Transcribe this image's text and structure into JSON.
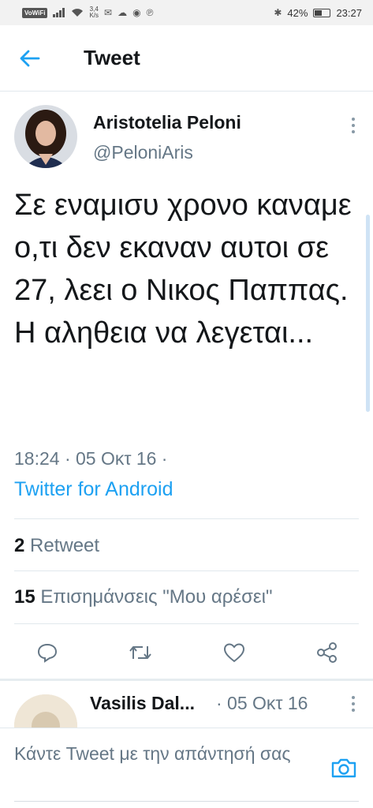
{
  "status_bar": {
    "vowifi": "VoWiFi",
    "speed_value": "3,4",
    "speed_unit": "K/s",
    "battery": "42%",
    "time": "23:27"
  },
  "header": {
    "title": "Tweet"
  },
  "tweet": {
    "author_name": "Aristotelia Peloni",
    "author_handle": "@PeloniAris",
    "text": "Σε εναμισυ χρονο καναμε ο,τι δεν εκαναν αυτοι σε 27, λεει ο Νικος Παππας. Η αληθεια να λεγεται...",
    "timestamp": "18:24 · 05 Οκτ 16 ·",
    "source": "Twitter for Android",
    "retweet_count": "2",
    "retweet_label": "Retweet",
    "like_count": "15",
    "like_label": "Επισημάνσεις \"Μου αρέσει\""
  },
  "reply": {
    "name": "Vasilis Dal...",
    "date": "· 05 Οκτ 16"
  },
  "composer": {
    "placeholder": "Κάντε Tweet με την απάντησή σας"
  },
  "colors": {
    "accent": "#1da1f2",
    "secondary_text": "#657786",
    "divider": "#e1e8ed"
  },
  "icons": [
    "back-arrow-icon",
    "more-vertical-icon",
    "reply-icon",
    "retweet-icon",
    "like-icon",
    "share-icon",
    "camera-icon"
  ]
}
